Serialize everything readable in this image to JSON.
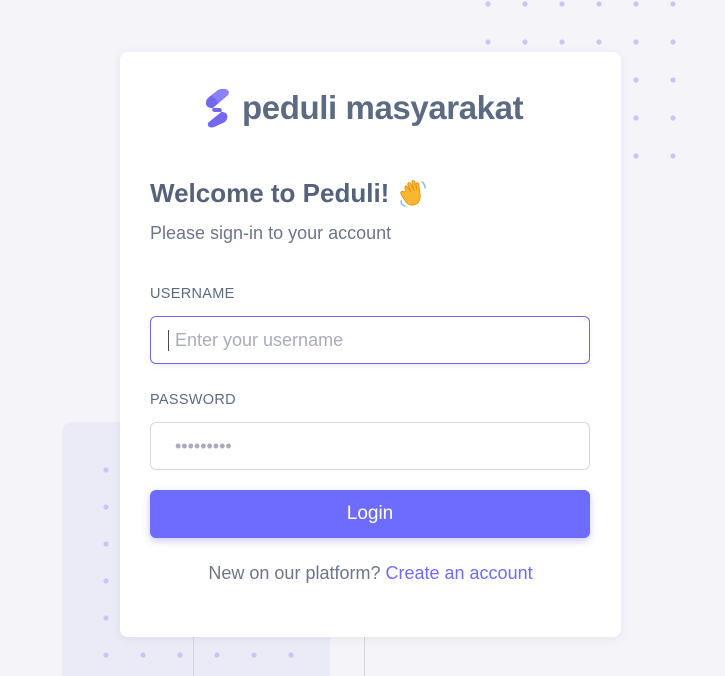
{
  "brand": {
    "name": "peduli masyarakat",
    "logo_icon": "brand-s-logo",
    "logo_color": "#7367f0"
  },
  "welcome": {
    "title": "Welcome to Peduli!",
    "emoji_icon": "waving-hand-icon",
    "subtitle": "Please sign-in to your account"
  },
  "form": {
    "username_label": "USERNAME",
    "username_placeholder": "Enter your username",
    "username_value": "",
    "password_label": "PASSWORD",
    "password_placeholder": "•••••••••",
    "password_value": ""
  },
  "actions": {
    "login_label": "Login"
  },
  "signup": {
    "prompt": "New on our platform?",
    "link_label": "Create an account"
  },
  "colors": {
    "primary": "#6e6bff",
    "background": "#f4f4f9",
    "text": "#5d6b82"
  }
}
